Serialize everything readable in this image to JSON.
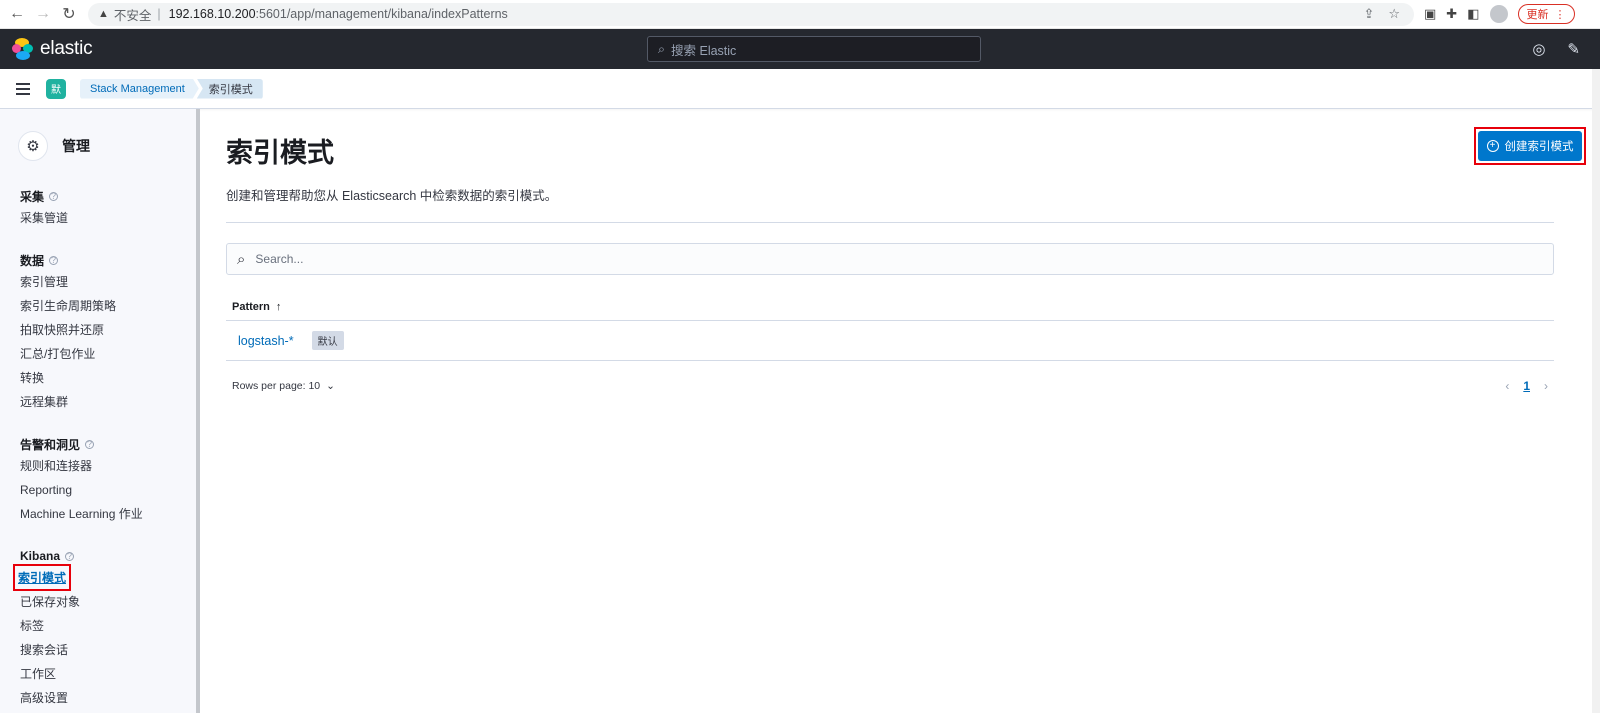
{
  "browser": {
    "insecure_label": "不安全",
    "url_host": "192.168.10.200",
    "url_path": ":5601/app/management/kibana/indexPatterns",
    "update_label": "更新"
  },
  "header": {
    "logo_text": "elastic",
    "search_placeholder": "搜索 Elastic"
  },
  "breadcrumb": {
    "space_initial": "默",
    "items": [
      "Stack Management",
      "索引模式"
    ]
  },
  "sidenav": {
    "title": "管理",
    "groups": [
      {
        "title": "采集",
        "items": [
          "采集管道"
        ]
      },
      {
        "title": "数据",
        "items": [
          "索引管理",
          "索引生命周期策略",
          "拍取快照并还原",
          "汇总/打包作业",
          "转换",
          "远程集群"
        ]
      },
      {
        "title": "告警和洞见",
        "items": [
          "规则和连接器",
          "Reporting",
          "Machine Learning 作业"
        ]
      },
      {
        "title": "Kibana",
        "items": [
          "索引模式",
          "已保存对象",
          "标签",
          "搜索会话",
          "工作区",
          "高级设置"
        ]
      }
    ]
  },
  "main": {
    "title": "索引模式",
    "description": "创建和管理帮助您从 Elasticsearch 中检索数据的索引模式。",
    "create_button": "创建索引模式",
    "search_placeholder": "Search...",
    "table": {
      "column_header": "Pattern",
      "rows": [
        {
          "pattern": "logstash-*",
          "badge": "默认"
        }
      ]
    },
    "rows_per_page": "Rows per page: 10",
    "current_page": "1"
  },
  "colors": {
    "header_bg": "#25282f",
    "primary_button": "#0077cc",
    "link": "#006bb8",
    "highlight_outline": "#e7000b"
  }
}
